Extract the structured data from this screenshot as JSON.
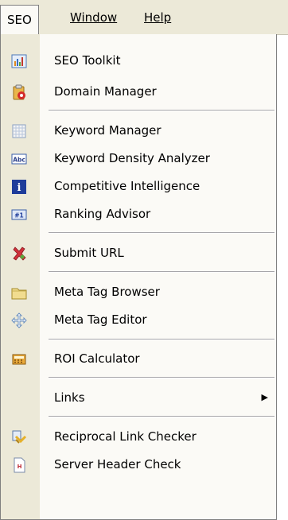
{
  "menubar": {
    "seo": "SEO",
    "window": "Window",
    "help": "Help"
  },
  "menu": {
    "items": [
      {
        "label": "SEO Toolkit",
        "icon": "bar-chart-icon"
      },
      {
        "label": "Domain Manager",
        "icon": "clipboard-icon"
      },
      {
        "label": "Keyword Manager",
        "icon": "grid-icon"
      },
      {
        "label": "Keyword Density Analyzer",
        "icon": "abc-icon"
      },
      {
        "label": "Competitive Intelligence",
        "icon": "info-icon"
      },
      {
        "label": "Ranking Advisor",
        "icon": "ranking-icon"
      },
      {
        "label": "Submit URL",
        "icon": "cross-pushpin-icon"
      },
      {
        "label": "Meta Tag Browser",
        "icon": "folder-icon"
      },
      {
        "label": "Meta Tag Editor",
        "icon": "move-icon"
      },
      {
        "label": "ROI Calculator",
        "icon": "calculator-icon"
      },
      {
        "label": "Links",
        "icon": ""
      },
      {
        "label": "Reciprocal Link Checker",
        "icon": "link-check-icon"
      },
      {
        "label": "Server Header Check",
        "icon": "document-header-icon"
      }
    ],
    "submenu_arrow": "▶"
  }
}
